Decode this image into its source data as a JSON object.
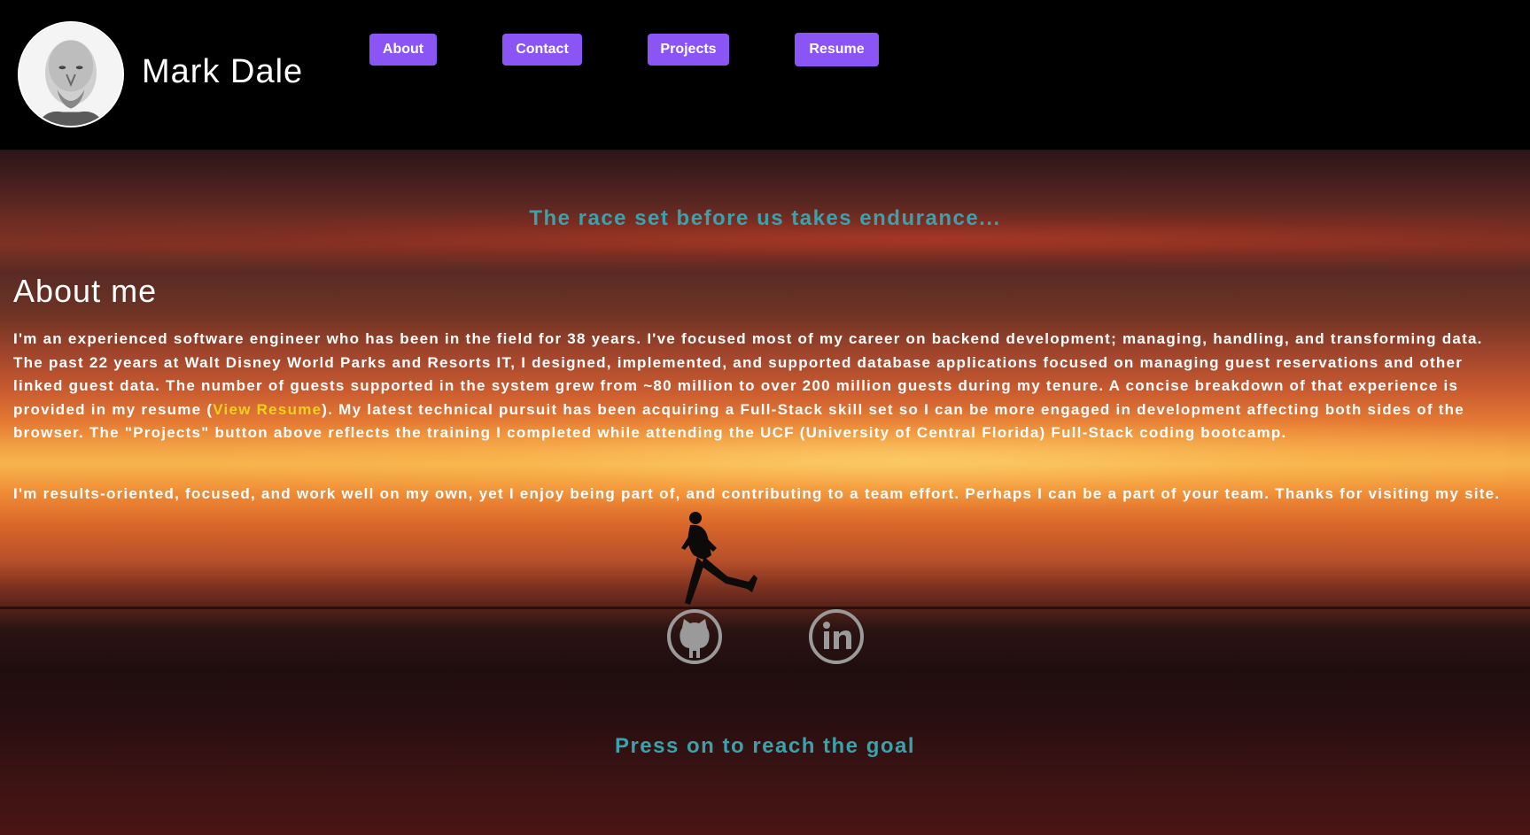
{
  "header": {
    "name": "Mark Dale",
    "nav": [
      {
        "label": "About"
      },
      {
        "label": "Contact"
      },
      {
        "label": "Projects"
      },
      {
        "label": "Resume"
      }
    ],
    "nav_color": "#8b55f5"
  },
  "hero": {
    "tagline_top": "The race set before us takes endurance...",
    "tagline_bottom": "Press on to reach the goal",
    "tagline_color": "#3aa2ad"
  },
  "about": {
    "title": "About me",
    "para1_before": "I'm an experienced software engineer who has been in the field for 38 years. I've focused most of my career on backend development; managing, handling, and transforming data. The past 22 years at Walt Disney World Parks and Resorts IT, I designed, implemented, and supported database applications focused on managing guest reservations and other linked guest data. The number of guests supported in the system grew from ~80 million to over 200 million guests during my tenure. A concise breakdown of that experience is provided in my resume (",
    "resume_link": "View Resume",
    "para1_after": "). My latest technical pursuit has been acquiring a Full-Stack skill set so I can be more engaged in development affecting both sides of the browser. The \"Projects\" button above reflects the training I completed while attending the UCF (University of Central Florida) Full-Stack coding bootcamp.",
    "para2": "I'm results-oriented, focused, and work well on my own, yet I enjoy being part of, and contributing to a team effort. Perhaps I can be a part of your team. Thanks for visiting my site.",
    "link_color": "#f0d21a"
  },
  "social": {
    "icons": [
      "github-icon",
      "linkedin-icon"
    ]
  },
  "images": {
    "avatar": "profile-photo",
    "runner": "runner-silhouette"
  }
}
